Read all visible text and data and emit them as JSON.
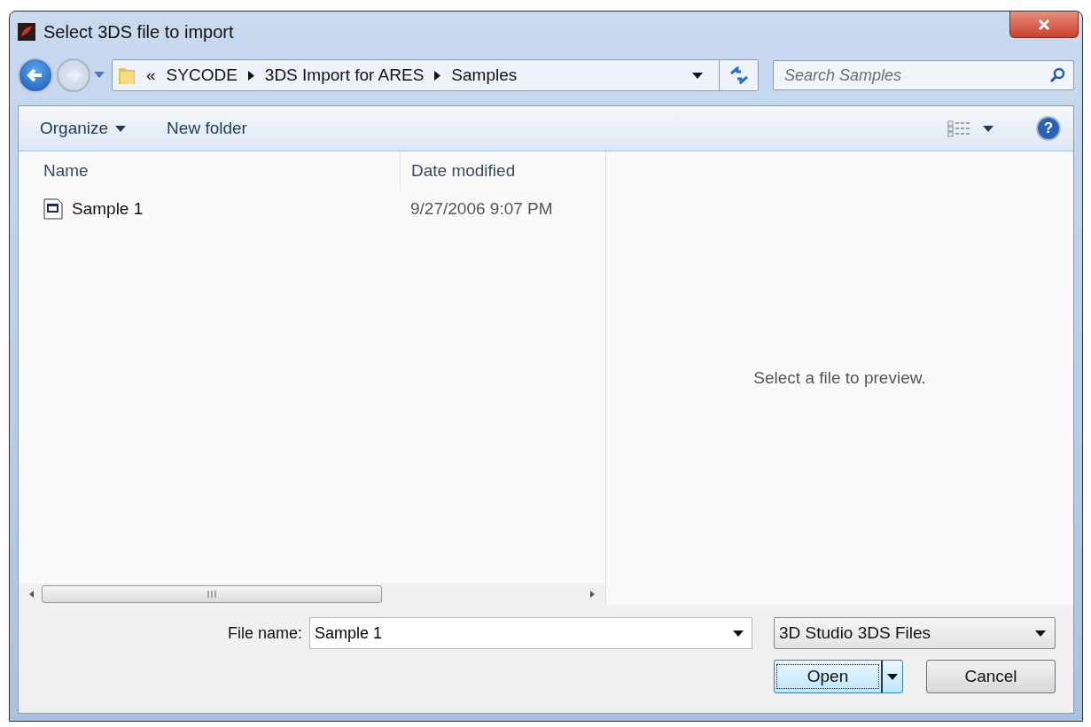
{
  "window": {
    "title": "Select 3DS file to import"
  },
  "breadcrumb": {
    "overflow": "«",
    "parts": [
      "SYCODE",
      "3DS Import for ARES",
      "Samples"
    ]
  },
  "search": {
    "placeholder": "Search Samples"
  },
  "toolbar": {
    "organize": "Organize",
    "new_folder": "New folder"
  },
  "columns": [
    "Name",
    "Date modified"
  ],
  "files": [
    {
      "name": "Sample 1",
      "date": "9/27/2006 9:07 PM",
      "selected": false
    }
  ],
  "help": {
    "glyph": "?"
  },
  "preview": {
    "message": "Select a file to preview."
  },
  "file_name": {
    "label": "File name:",
    "value": "Sample 1"
  },
  "file_type": {
    "value": "3D Studio 3DS Files"
  },
  "buttons": {
    "open": "Open",
    "cancel": "Cancel"
  }
}
